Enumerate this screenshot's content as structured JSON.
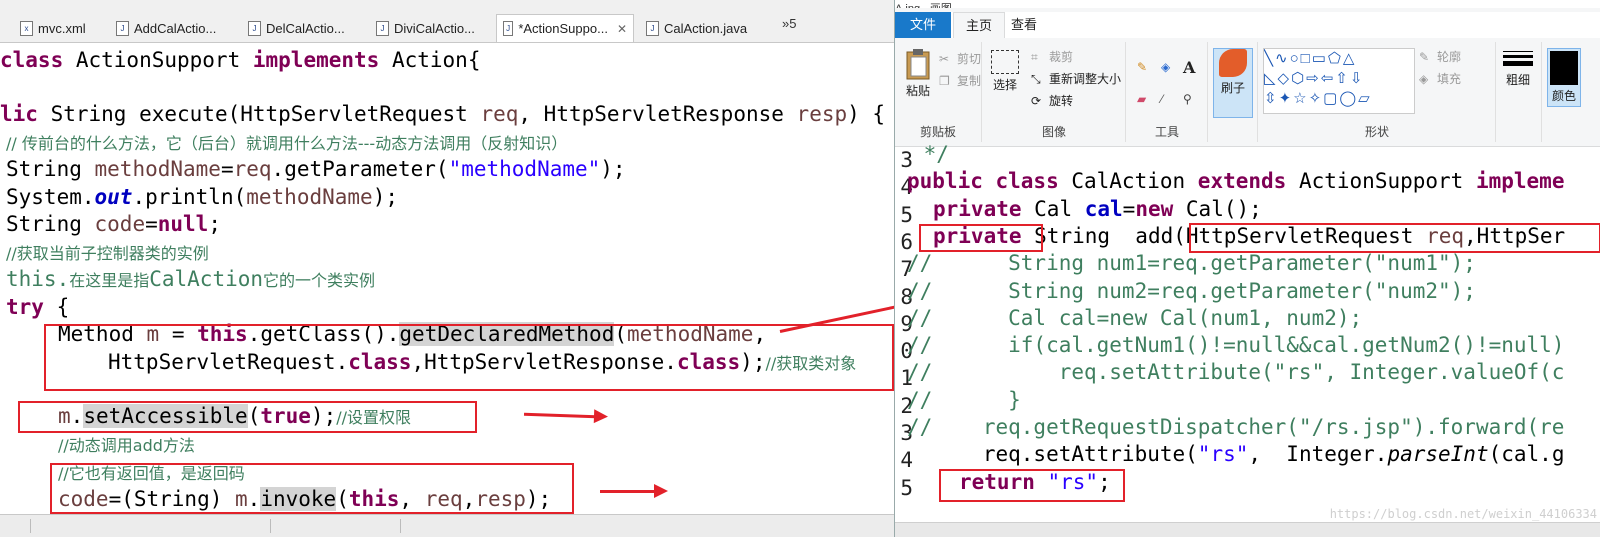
{
  "left_editor": {
    "tabs": [
      {
        "label": "mvc.xml",
        "icon": "xml-file-icon"
      },
      {
        "label": "AddCalActio...",
        "icon": "java-file-icon"
      },
      {
        "label": "DelCalActio...",
        "icon": "java-file-icon"
      },
      {
        "label": "DiviCalActio...",
        "icon": "java-file-icon"
      },
      {
        "label": "*ActionSuppo...",
        "icon": "java-file-icon",
        "active": true
      },
      {
        "label": "CalAction.java",
        "icon": "java-file-icon"
      }
    ],
    "overflow_label": "»5",
    "code": {
      "l1_kw": "class",
      "l1_a": " ActionSupport ",
      "l1_kw2": "implements",
      "l1_b": " Action{",
      "l2_kw": "lic",
      "l2_a": " String execute(HttpServletRequest ",
      "l2_v1": "req",
      "l2_b": ", HttpServletResponse ",
      "l2_v2": "resp",
      "l2_c": ") {",
      "l3_cmt": "// 传前台的什么方法，它（后台）就调用什么方法---动态方法调用（反射知识）",
      "l4_a": "String ",
      "l4_v": "methodName",
      "l4_b": "=",
      "l4_v2": "req",
      "l4_c": ".getParameter(",
      "l4_s": "\"methodName\"",
      "l4_d": ");",
      "l5_a": "System.",
      "l5_f": "out",
      "l5_b": ".println(",
      "l5_v": "methodName",
      "l5_c": ");",
      "l6_a": "String ",
      "l6_v": "code",
      "l6_b": "=",
      "l6_kw": "null",
      "l6_c": ";",
      "l7_cmt": "//获取当前子控制器类的实例",
      "l8_cmt1": "this.",
      "l8_cmt2": "在这里是指",
      "l8_cmt3": "CalAction",
      "l8_cmt4": "它的一个类实例",
      "l9_kw": "try",
      "l9_a": " {",
      "l10_a": "Method ",
      "l10_v": "m",
      "l10_b": " = ",
      "l10_kw": "this",
      "l10_c": ".getClass().",
      "l10_h": "getDeclaredMethod",
      "l10_d": "(",
      "l10_v2": "methodName",
      "l10_e": ",",
      "l11_a": "HttpServletRequest.",
      "l11_kw": "class",
      "l11_b": ",HttpServletResponse.",
      "l11_kw2": "class",
      "l11_c": ");",
      "l11_cmt": "//获取类对象",
      "l12_v": "m",
      "l12_a": ".",
      "l12_h": "setAccessible",
      "l12_b": "(",
      "l12_kw": "true",
      "l12_c": ");",
      "l12_cmt": "//设置权限",
      "l13_cmt": "//动态调用add方法",
      "l14_cmt": "//它也有返回值，是返回码",
      "l15_v": "code",
      "l15_a": "=(String) ",
      "l15_v2": "m",
      "l15_b": ".",
      "l15_h": "invoke",
      "l15_c": "(",
      "l15_kw": "this",
      "l15_d": ", ",
      "l15_v3": "req",
      "l15_e": ",",
      "l15_v4": "resp",
      "l15_f": ");"
    }
  },
  "right_paint": {
    "title": "A.jpg - 画图",
    "tabs": {
      "file": "文件",
      "home": "主页",
      "view": "查看"
    },
    "clipboard": {
      "paste": "粘贴",
      "cut": "剪切",
      "copy": "复制",
      "label": "剪贴板"
    },
    "image": {
      "select": "选择",
      "crop": "裁剪",
      "resize": "重新调整大小",
      "rotate": "旋转",
      "label": "图像"
    },
    "tools": {
      "label": "工具"
    },
    "brush": {
      "label": "刷子"
    },
    "shapes": {
      "outline": "轮廓",
      "fill": "填充",
      "label": "形状"
    },
    "size": {
      "label": "粗细"
    },
    "color": {
      "label": "颜色"
    },
    "line_numbers": [
      "3",
      "4",
      "5",
      "6",
      "7",
      "8",
      "9",
      "0",
      "1",
      "2",
      "3",
      "4",
      "5"
    ],
    "code": {
      "l3": " */",
      "l4_kw": "public class",
      "l4_a": " CalAction ",
      "l4_kw2": "extends",
      "l4_b": " ActionSupport ",
      "l4_kw3": "impleme",
      "l5_kw": "private",
      "l5_a": " Cal ",
      "l5_v": "cal",
      "l5_b": "=",
      "l5_kw2": "new",
      "l5_c": " Cal();",
      "l6_kw": "private",
      "l6_a": " String  add(HttpServletRequest ",
      "l6_v": "req",
      "l6_b": ",HttpSer",
      "l7": "//      String num1=req.getParameter(\"num1\");",
      "l8": "//      String num2=req.getParameter(\"num2\");",
      "l9": "//      Cal cal=new Cal(num1, num2);",
      "l10": "//      if(cal.getNum1()!=null&&cal.getNum2()!=null)",
      "l11": "//          req.setAttribute(\"rs\", Integer.valueOf(c",
      "l12": "//      }",
      "l13": "//    req.getRequestDispatcher(\"/rs.jsp\").forward(re",
      "l14_a": "      req.setAttribute(",
      "l14_s": "\"rs\"",
      "l14_b": ",  Integer.",
      "l14_i": "parseInt",
      "l14_c": "(cal.g",
      "l15_kw": "return",
      "l15_s": " \"rs\"",
      "l15_a": ";"
    },
    "watermark": "https://blog.csdn.net/weixin_44106334"
  },
  "colors": {
    "annotation_red": "#e2212a",
    "keyword": "#7f0055",
    "string": "#2a00ff",
    "comment": "#3f7f5f",
    "file_tab": "#1979ca"
  }
}
